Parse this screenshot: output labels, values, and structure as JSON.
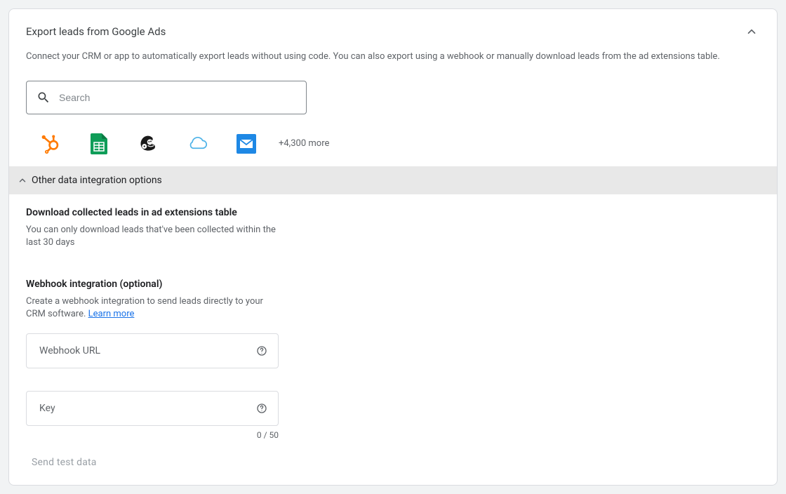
{
  "header": {
    "title": "Export leads from Google Ads",
    "subtitle": "Connect your CRM or app to automatically export leads without using code. You can also export using a webhook or manually download leads from the ad extensions table."
  },
  "search": {
    "placeholder": "Search"
  },
  "apps": {
    "more_text": "+4,300 more"
  },
  "other_options": {
    "label": "Other data integration options"
  },
  "download": {
    "title": "Download collected leads in ad extensions table",
    "desc": "You can only download leads that've been collected within the last 30 days"
  },
  "webhook": {
    "title": "Webhook integration (optional)",
    "desc_prefix": "Create a webhook integration to send leads directly to your CRM software. ",
    "learn_more": "Learn more",
    "url_label": "Webhook URL",
    "key_label": "Key",
    "char_count": "0 / 50",
    "send_test": "Send test data"
  }
}
